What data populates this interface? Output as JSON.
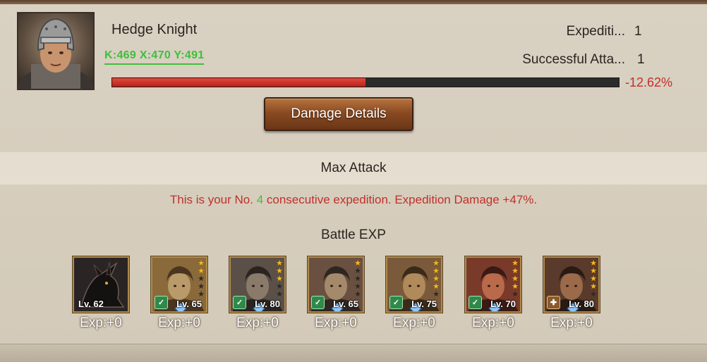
{
  "commander": {
    "name": "Hedge Knight",
    "coords": "K:469 X:470 Y:491",
    "stats": [
      {
        "label": "Expediti...",
        "value": "1"
      },
      {
        "label": "Successful Atta...",
        "value": "1"
      }
    ],
    "health_fraction": 0.5,
    "change_text": "-12.62%"
  },
  "buttons": {
    "damage_details": "Damage Details"
  },
  "sections": {
    "max_attack": "Max Attack",
    "notice_before": "This is your No. ",
    "notice_number": "4",
    "notice_after": " consecutive expedition. Expedition Damage +47%.",
    "battle_exp": "Battle EXP"
  },
  "heroes": [
    {
      "level": "Lv. 62",
      "exp": "Exp:+0",
      "stars": 0,
      "badge": "none",
      "icon": "dragon-portrait"
    },
    {
      "level": "Lv. 65",
      "exp": "Exp:+0",
      "stars": 2,
      "badge": "green",
      "icon": "hero-portrait"
    },
    {
      "level": "Lv. 80",
      "exp": "Exp:+0",
      "stars": 3,
      "badge": "green",
      "icon": "hero-portrait"
    },
    {
      "level": "Lv. 65",
      "exp": "Exp:+0",
      "stars": 1,
      "badge": "green",
      "icon": "hero-portrait"
    },
    {
      "level": "Lv. 75",
      "exp": "Exp:+0",
      "stars": 4,
      "badge": "green",
      "icon": "hero-portrait"
    },
    {
      "level": "Lv. 70",
      "exp": "Exp:+0",
      "stars": 4,
      "badge": "green",
      "icon": "hero-portrait"
    },
    {
      "level": "Lv. 80",
      "exp": "Exp:+0",
      "stars": 4,
      "badge": "brown",
      "icon": "hero-portrait"
    }
  ],
  "colors": {
    "accent_red": "#c0312a",
    "accent_green": "#3fbf3c",
    "bar_fill": "#d33a31",
    "button_brown": "#8a4b22"
  }
}
